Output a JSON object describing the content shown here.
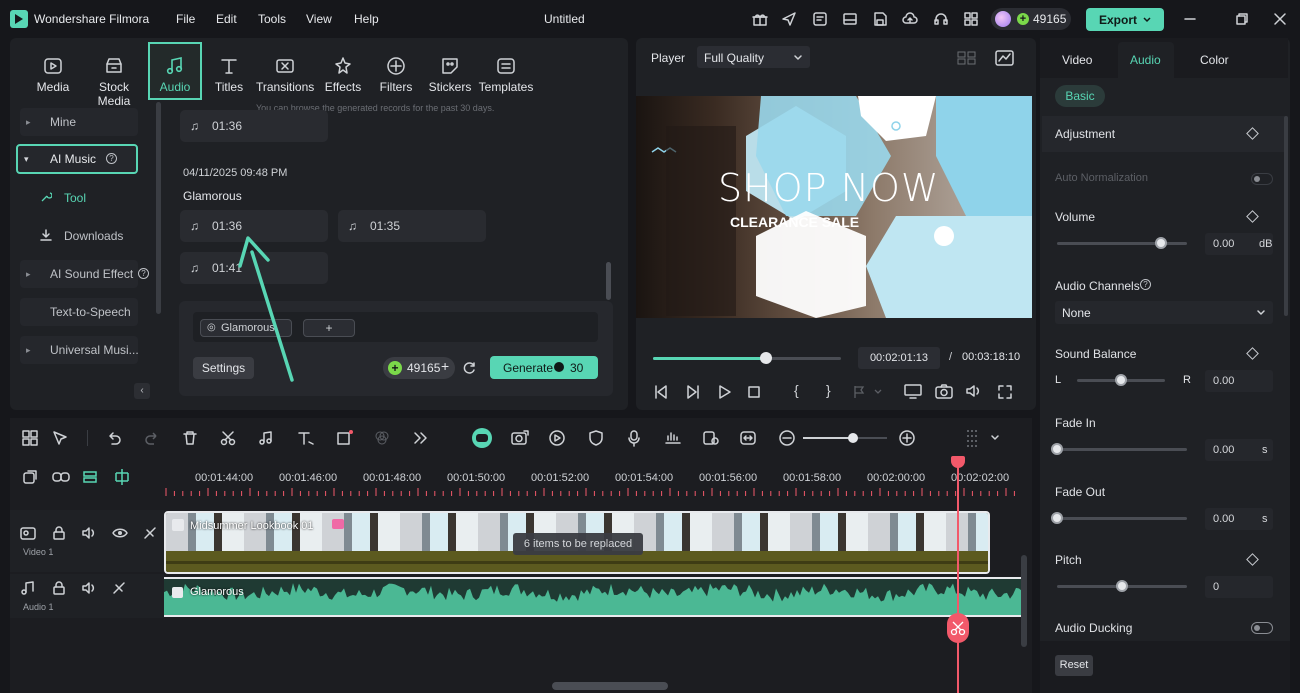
{
  "app": {
    "name": "Wondershare Filmora",
    "doc_title": "Untitled",
    "credits": "49165",
    "export_label": "Export"
  },
  "menu": [
    "File",
    "Edit",
    "Tools",
    "View",
    "Help"
  ],
  "media_tabs": [
    {
      "label": "Media",
      "icon": "media-icon"
    },
    {
      "label": "Stock Media",
      "icon": "stock-media-icon"
    },
    {
      "label": "Audio",
      "icon": "music-note-icon",
      "active": true
    },
    {
      "label": "Titles",
      "icon": "titles-icon"
    },
    {
      "label": "Transitions",
      "icon": "transitions-icon"
    },
    {
      "label": "Effects",
      "icon": "effects-icon"
    },
    {
      "label": "Filters",
      "icon": "filters-icon"
    },
    {
      "label": "Stickers",
      "icon": "stickers-icon"
    },
    {
      "label": "Templates",
      "icon": "templates-icon"
    }
  ],
  "sidebar": {
    "items": [
      {
        "label": "Mine"
      },
      {
        "label": "AI Music"
      },
      {
        "label": "Tool"
      },
      {
        "label": "Downloads"
      },
      {
        "label": "AI Sound Effect"
      },
      {
        "label": "Text-to-Speech"
      },
      {
        "label": "Universal Musi..."
      }
    ]
  },
  "library": {
    "hint": "You can browse the generated records for the past 30 days.",
    "top_card": "01:36",
    "record_date": "04/11/2025 09:48 PM",
    "record_name": "Glamorous",
    "cards": [
      "01:36",
      "01:35",
      "01:41"
    ],
    "prompt_tag": "Glamorous",
    "add_label": "+",
    "settings_label": "Settings",
    "credits": "49165",
    "generate_label": "Generate",
    "generate_cost": "30"
  },
  "player": {
    "label": "Player",
    "quality": "Full Quality",
    "current_time": "00:02:01:13",
    "separator": "/",
    "total_time": "00:03:18:10",
    "progress": 0.6,
    "overlay_title": "SHOP NOW",
    "overlay_subtitle": "CLEARANCE SALE"
  },
  "right_panel": {
    "tabs": [
      "Video",
      "Audio",
      "Color"
    ],
    "active_tab": "Audio",
    "basic_label": "Basic",
    "adjustment": "Adjustment",
    "auto_normalization": "Auto Normalization",
    "volume": {
      "label": "Volume",
      "value": "0.00",
      "unit": "dB",
      "level": 0.8
    },
    "audio_channels": {
      "label": "Audio Channels",
      "value": "None"
    },
    "sound_balance": {
      "label": "Sound Balance",
      "left": "L",
      "right": "R",
      "value": "0.00",
      "level": 0.5
    },
    "fade_in": {
      "label": "Fade In",
      "value": "0.00",
      "unit": "s",
      "level": 0
    },
    "fade_out": {
      "label": "Fade Out",
      "value": "0.00",
      "unit": "s",
      "level": 0
    },
    "pitch": {
      "label": "Pitch",
      "value": "0",
      "level": 0.5
    },
    "audio_ducking": "Audio Ducking",
    "reset_label": "Reset"
  },
  "timeline": {
    "ruler": [
      "00:01:44:00",
      "00:01:46:00",
      "00:01:48:00",
      "00:01:50:00",
      "00:01:52:00",
      "00:01:54:00",
      "00:01:56:00",
      "00:01:58:00",
      "00:02:00:00",
      "00:02:02:00"
    ],
    "video_track": "Video 1",
    "audio_track": "Audio 1",
    "video_clip": "Midsummer Lookbook 01",
    "replace_badge": "6 items to be replaced",
    "audio_clip": "Glamorous"
  },
  "colors": {
    "accent": "#58d6b4",
    "brand_bg": "#16171b",
    "playhead": "#f2596a"
  }
}
